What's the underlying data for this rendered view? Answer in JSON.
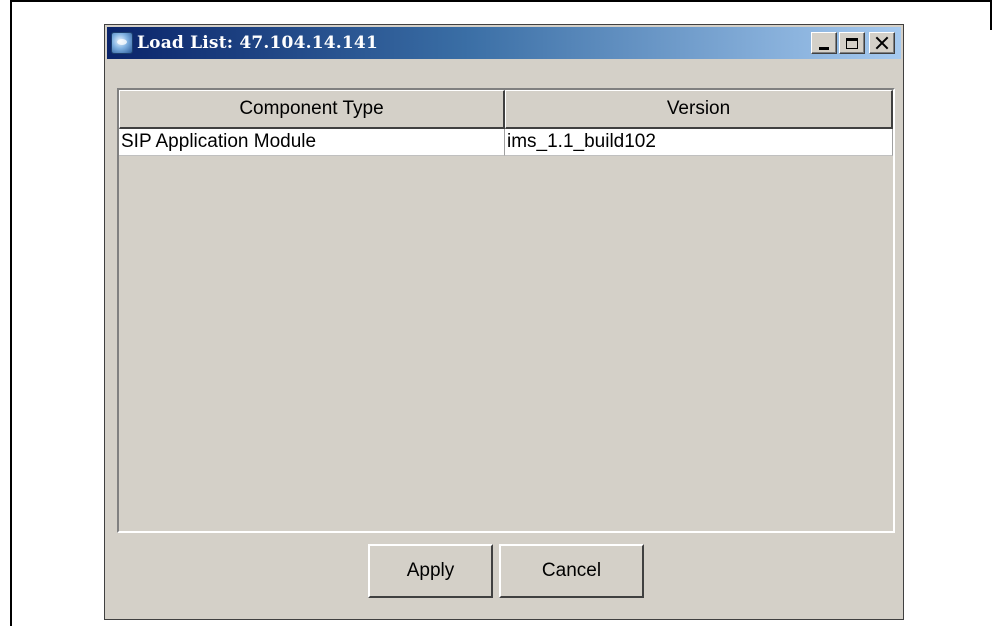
{
  "window": {
    "title": "Load List: 47.104.14.141",
    "buttons": {
      "minimize": "minimize-icon",
      "maximize": "maximize-icon",
      "close": "close-icon"
    }
  },
  "table": {
    "columns": [
      "Component Type",
      "Version"
    ],
    "rows": [
      [
        "SIP Application Module",
        "ims_1.1_build102"
      ]
    ]
  },
  "actions": {
    "apply_label": "Apply",
    "cancel_label": "Cancel"
  },
  "colors": {
    "title_gradient_start": "#0a246a",
    "title_gradient_end": "#a6caf0",
    "face": "#d4d0c8"
  }
}
